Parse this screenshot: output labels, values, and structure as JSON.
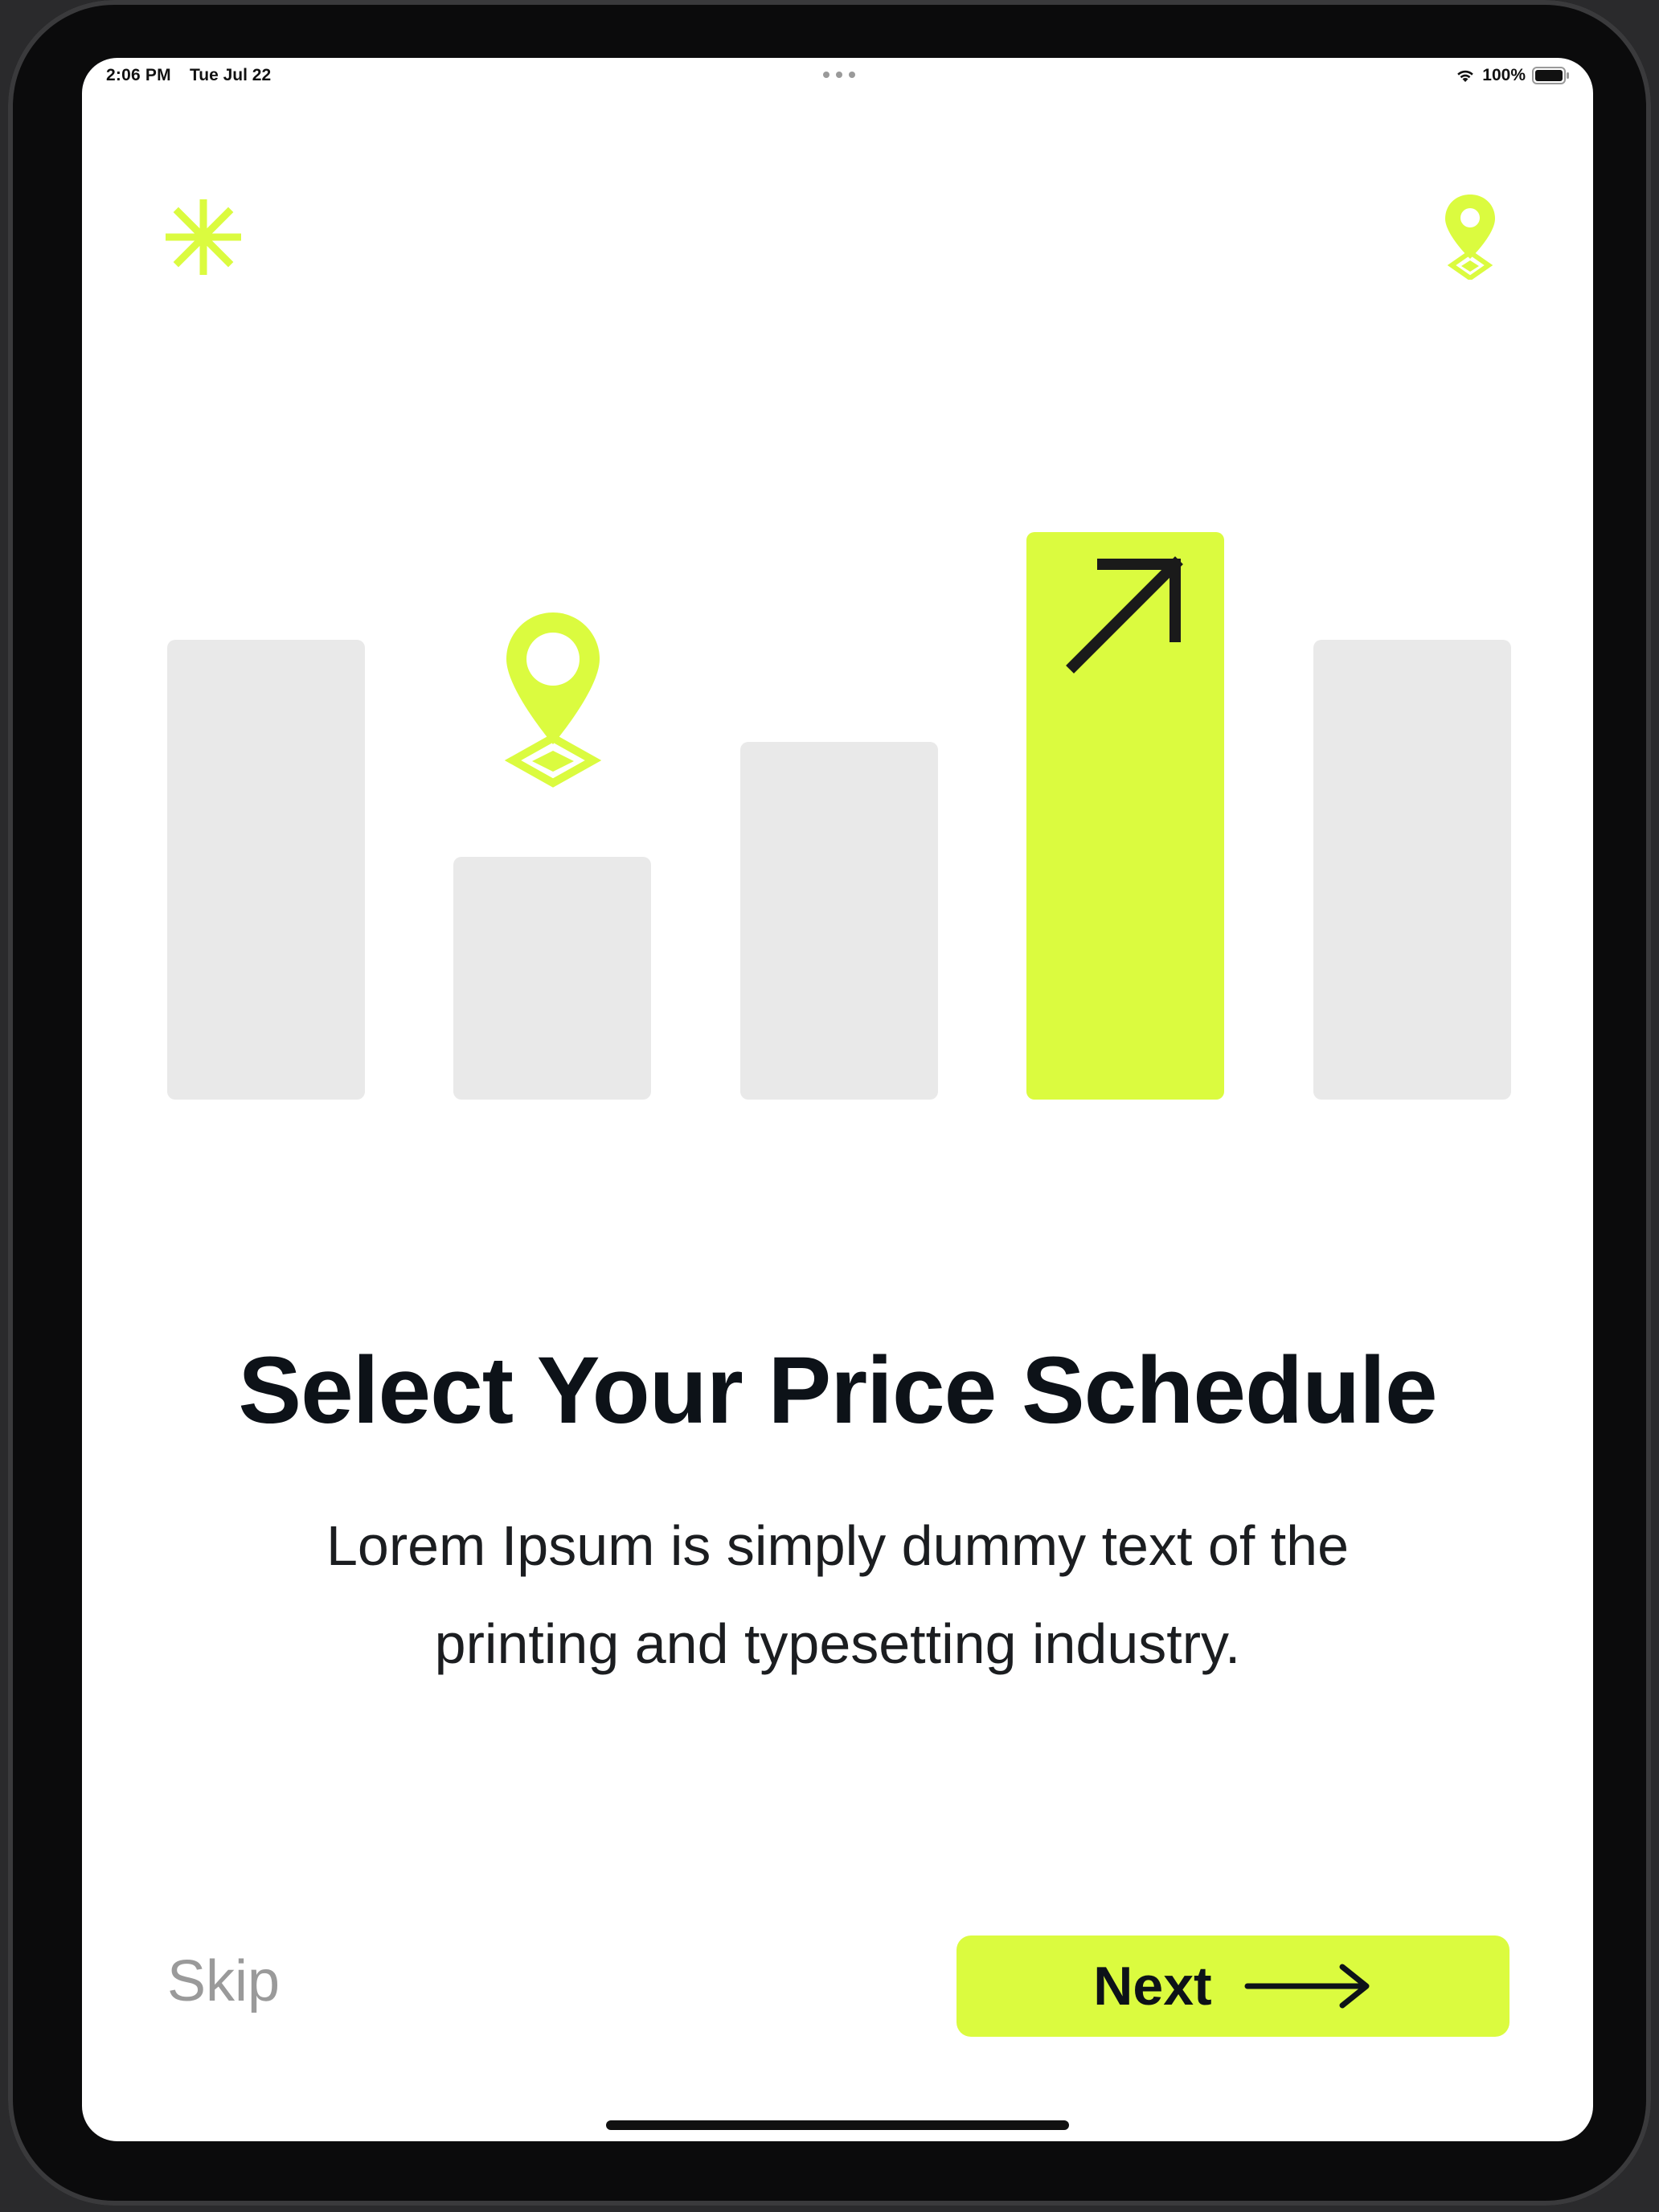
{
  "status_bar": {
    "time": "2:06 PM",
    "date": "Tue Jul 22",
    "battery_percent": "100%",
    "icons": [
      "wifi-icon",
      "battery-icon",
      "multitasking-dots-icon"
    ]
  },
  "header": {
    "left_icon": "asterisk-icon",
    "right_icon": "location-pin-icon"
  },
  "illustration": {
    "bars": [
      {
        "name": "bar-1",
        "color": "#e9e9e9"
      },
      {
        "name": "bar-2",
        "color": "#e9e9e9",
        "icon": "location-pin-icon"
      },
      {
        "name": "bar-3",
        "color": "#e9e9e9"
      },
      {
        "name": "bar-4",
        "color": "#dbfb3f",
        "icon": "arrow-up-right-icon"
      },
      {
        "name": "bar-5",
        "color": "#e9e9e9"
      }
    ]
  },
  "content": {
    "title": "Select Your Price Schedule",
    "subtitle": "Lorem Ipsum is simply dummy text of the printing and typesetting industry."
  },
  "footer": {
    "skip_label": "Skip",
    "next_label": "Next",
    "next_icon": "arrow-right-icon"
  },
  "colors": {
    "accent": "#dbfb3f",
    "bar_gray": "#e9e9e9",
    "title_text": "#0d1218",
    "skip_text": "#9a9a9a"
  }
}
